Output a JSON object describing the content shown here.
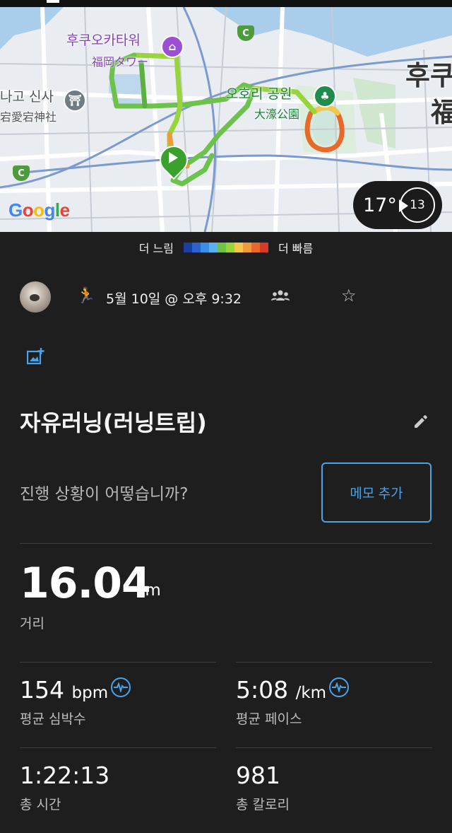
{
  "map": {
    "labels": {
      "tower_kr": "후쿠오카타워",
      "tower_jp": "福岡タワー",
      "shrine_kr": "나고 신사",
      "shrine_jp": "宕愛宕神社",
      "park_kr": "오호리 공원",
      "park_jp": "大濠公園",
      "city_kr": "후쿠",
      "city_jp": "福",
      "c_badge": "C"
    },
    "google_letters": [
      "G",
      "o",
      "o",
      "g",
      "l",
      "e"
    ],
    "weather": {
      "temp": "17°",
      "wind": "13"
    }
  },
  "legend": {
    "slow": "더 느림",
    "fast": "더 빠름",
    "colors": [
      "#1a3f9c",
      "#2a63d0",
      "#3b8ee8",
      "#5ab0f0",
      "#6cc24a",
      "#9ad43c",
      "#f2c84a",
      "#f29a3a",
      "#e86a2a",
      "#d83a2a"
    ]
  },
  "activity": {
    "datetime": "5월 10일 @ 오후 9:32",
    "title": "자유러닝(러닝트립)",
    "question": "진행 상황이 어떻습니까?",
    "memo_button": "메모 추가"
  },
  "stats": {
    "distance": {
      "value": "16.04",
      "unit": "km",
      "label": "거리"
    },
    "heart_rate": {
      "value": "154",
      "unit": "bpm",
      "label": "평균 심박수"
    },
    "pace": {
      "value": "5:08",
      "unit": "/km",
      "label": "평균 페이스"
    },
    "time": {
      "value": "1:22:13",
      "label": "총 시간"
    },
    "calories": {
      "value": "981",
      "label": "총 칼로리"
    }
  },
  "colors": {
    "accent": "#4aa3e6",
    "background": "#1e1e1e"
  }
}
